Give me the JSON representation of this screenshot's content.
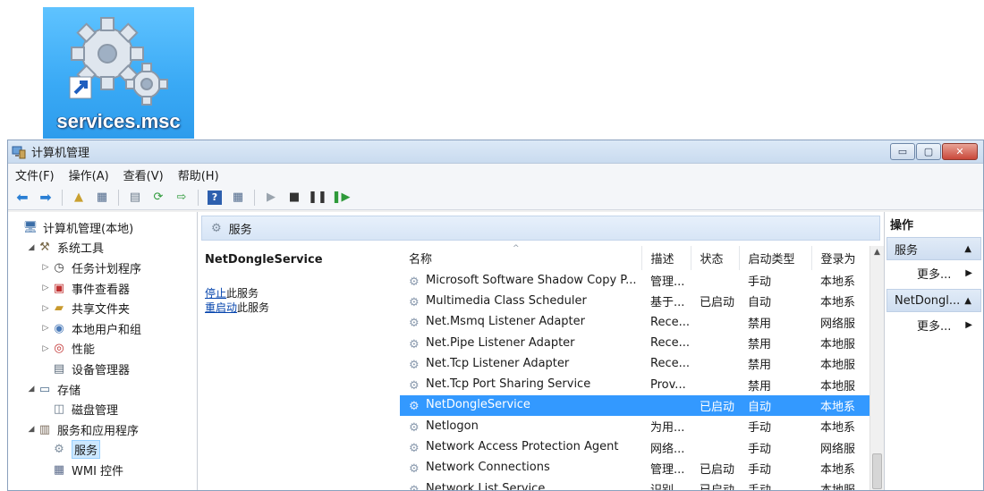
{
  "shortcut": {
    "label": "services.msc"
  },
  "window": {
    "title": "计算机管理",
    "buttons": {
      "minimize": "▭",
      "maximize": "▢",
      "close": "✕"
    }
  },
  "menu": [
    "文件(F)",
    "操作(A)",
    "查看(V)",
    "帮助(H)"
  ],
  "tree": [
    {
      "label": "计算机管理(本地)",
      "icon": "computer-icon",
      "indent": 0,
      "twisty": ""
    },
    {
      "label": "系统工具",
      "icon": "tools-icon",
      "indent": 1,
      "twisty": "◢"
    },
    {
      "label": "任务计划程序",
      "icon": "clock-icon",
      "indent": 2,
      "twisty": "▷"
    },
    {
      "label": "事件查看器",
      "icon": "event-icon",
      "indent": 2,
      "twisty": "▷"
    },
    {
      "label": "共享文件夹",
      "icon": "shared-folder-icon",
      "indent": 2,
      "twisty": "▷"
    },
    {
      "label": "本地用户和组",
      "icon": "users-icon",
      "indent": 2,
      "twisty": "▷"
    },
    {
      "label": "性能",
      "icon": "performance-icon",
      "indent": 2,
      "twisty": "▷"
    },
    {
      "label": "设备管理器",
      "icon": "device-icon",
      "indent": 2,
      "twisty": ""
    },
    {
      "label": "存储",
      "icon": "storage-icon",
      "indent": 1,
      "twisty": "◢"
    },
    {
      "label": "磁盘管理",
      "icon": "disk-icon",
      "indent": 2,
      "twisty": ""
    },
    {
      "label": "服务和应用程序",
      "icon": "apps-icon",
      "indent": 1,
      "twisty": "◢"
    },
    {
      "label": "服务",
      "icon": "gear-icon",
      "indent": 2,
      "twisty": "",
      "selected": true
    },
    {
      "label": "WMI 控件",
      "icon": "wmi-icon",
      "indent": 2,
      "twisty": ""
    }
  ],
  "middle": {
    "header": "服务",
    "selected_service": "NetDongleService",
    "actions": [
      {
        "link": "停止",
        "rest": "此服务"
      },
      {
        "link": "重启动",
        "rest": "此服务"
      }
    ]
  },
  "columns": [
    "名称",
    "描述",
    "状态",
    "启动类型",
    "登录为"
  ],
  "services": [
    [
      "Microsoft Software Shadow Copy P...",
      "管理...",
      "",
      "手动",
      "本地系"
    ],
    [
      "Multimedia Class Scheduler",
      "基于...",
      "已启动",
      "自动",
      "本地系"
    ],
    [
      "Net.Msmq Listener Adapter",
      "Rece...",
      "",
      "禁用",
      "网络服"
    ],
    [
      "Net.Pipe Listener Adapter",
      "Rece...",
      "",
      "禁用",
      "本地服"
    ],
    [
      "Net.Tcp Listener Adapter",
      "Rece...",
      "",
      "禁用",
      "本地服"
    ],
    [
      "Net.Tcp Port Sharing Service",
      "Prov...",
      "",
      "禁用",
      "本地服"
    ],
    [
      "NetDongleService",
      "",
      "已启动",
      "自动",
      "本地系"
    ],
    [
      "Netlogon",
      "为用...",
      "",
      "手动",
      "本地系"
    ],
    [
      "Network Access Protection Agent",
      "网络...",
      "",
      "手动",
      "网络服"
    ],
    [
      "Network Connections",
      "管理...",
      "已启动",
      "手动",
      "本地系"
    ],
    [
      "Network List Service",
      "识别...",
      "已启动",
      "手动",
      "本地服"
    ]
  ],
  "selected_row": 6,
  "action_pane": {
    "title": "操作",
    "groups": [
      {
        "label": "服务",
        "more": "更多..."
      },
      {
        "label": "NetDongl...",
        "more": "更多..."
      }
    ]
  },
  "colors": {
    "selection": "#3399ff",
    "link": "#0645ad",
    "shortcut_bg": "#39a9f5"
  }
}
